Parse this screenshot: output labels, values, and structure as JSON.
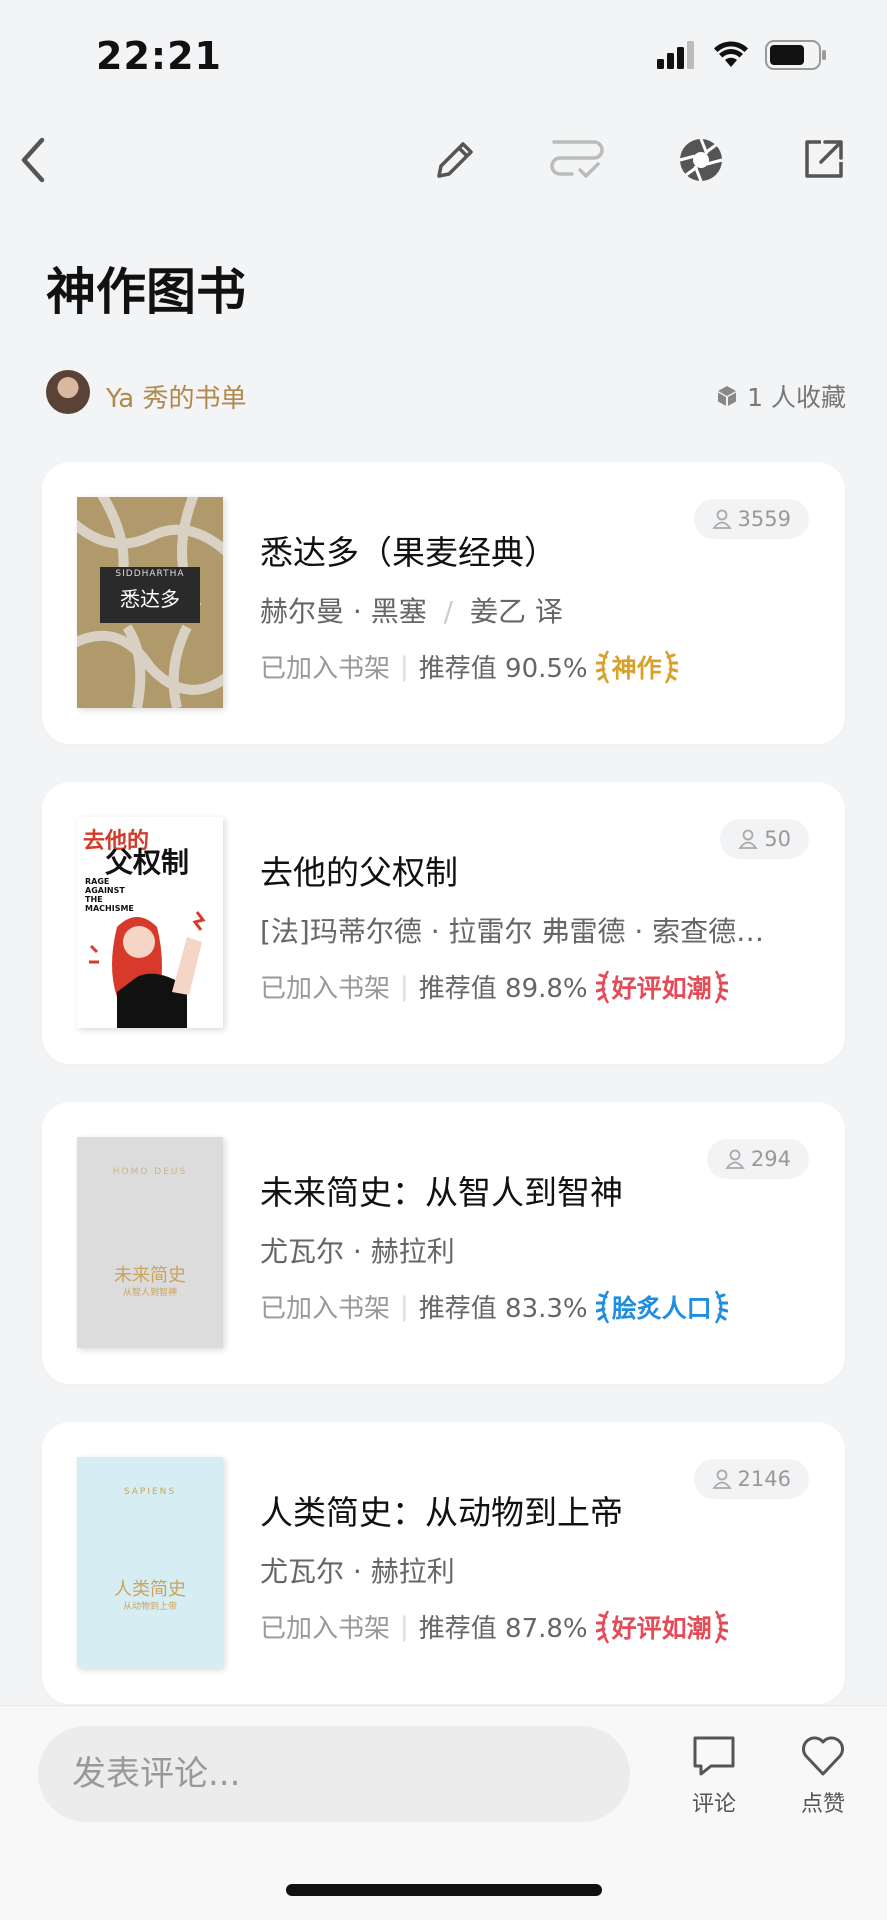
{
  "status_bar": {
    "time": "22:21"
  },
  "nav": {
    "icons": [
      "back-icon",
      "edit-icon",
      "checklist-icon",
      "aperture-icon",
      "share-icon"
    ]
  },
  "page": {
    "title": "神作图书"
  },
  "owner": {
    "name": "Ya 秀的书单",
    "favorites": "1 人收藏"
  },
  "books": [
    {
      "title": "悉达多（果麦经典）",
      "author": "赫尔曼 · 黑塞",
      "translator": "姜乙 译",
      "shelf": "已加入书架",
      "recommend": "推荐值 90.5%",
      "badge": "神作",
      "badge_color": "#d8a12b",
      "readers": "3559",
      "cover_title": "悉达多",
      "cover_en": "SIDDHARTHA"
    },
    {
      "title": "去他的父权制",
      "author": "[法]玛蒂尔德 · 拉雷尔 弗雷德 · 索查德 ...",
      "shelf": "已加入书架",
      "recommend": "推荐值 89.8%",
      "badge": "好评如潮",
      "badge_color": "#e34b57",
      "readers": "50",
      "cover_title_1": "去他的",
      "cover_title_2": "父权制",
      "cover_en": "RAGE AGAINST THE MACHISME"
    },
    {
      "title": "未来简史：从智人到智神",
      "author": "尤瓦尔 · 赫拉利",
      "shelf": "已加入书架",
      "recommend": "推荐值 83.3%",
      "badge": "脍炙人口",
      "badge_color": "#1f8ee0",
      "readers": "294",
      "cover_title": "未来简史",
      "cover_sub": "从智人到智神",
      "cover_en": "HOMO DEUS"
    },
    {
      "title": "人类简史：从动物到上帝",
      "author": "尤瓦尔 · 赫拉利",
      "shelf": "已加入书架",
      "recommend": "推荐值 87.8%",
      "badge": "好评如潮",
      "badge_color": "#e34b57",
      "readers": "2146",
      "cover_title": "人类简史",
      "cover_sub": "从动物到上帝",
      "cover_en": "SAPIENS"
    }
  ],
  "bottom": {
    "comment_placeholder": "发表评论...",
    "comment_label": "评论",
    "like_label": "点赞"
  }
}
